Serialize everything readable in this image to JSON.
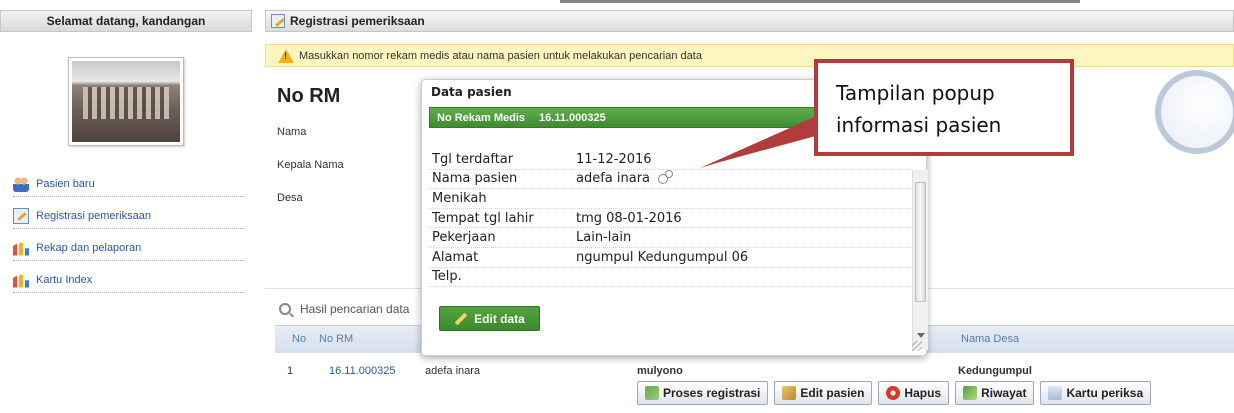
{
  "sidebar": {
    "welcome": "Selamat datang, kandangan",
    "items": [
      {
        "label": "Pasien baru",
        "icon": "users-icon"
      },
      {
        "label": "Registrasi pemeriksaan",
        "icon": "edit-form-icon"
      },
      {
        "label": "Rekap dan pelaporan",
        "icon": "bar-chart-icon"
      },
      {
        "label": "Kartu Index",
        "icon": "bar-chart-icon"
      }
    ]
  },
  "main": {
    "title": "Registrasi pemeriksaan",
    "alert": "Masukkan nomor rekam medis atau nama pasien untuk melakukan pencarian data",
    "heading": "No RM",
    "labels": {
      "nama": "Nama",
      "kepala": "Kepala Nama",
      "desa": "Desa"
    }
  },
  "results": {
    "title": "Hasil pencarian data",
    "columns": {
      "no": "No",
      "rm": "No RM",
      "desa": "Nama Desa"
    },
    "row": {
      "no": "1",
      "rm": "16.11.000325",
      "nama": "adefa inara",
      "kepala": "mulyono",
      "desa": "Kedungumpul"
    },
    "buttons": {
      "proses": "Proses registrasi",
      "edit": "Edit pasien",
      "hapus": "Hapus",
      "riwayat": "Riwayat",
      "kartu": "Kartu periksa"
    }
  },
  "popup": {
    "title": "Data pasien",
    "band_label": "No Rekam Medis",
    "band_value": "16.11.000325",
    "rows": [
      {
        "label": "Tgl terdaftar",
        "value": "11-12-2016"
      },
      {
        "label": "Nama pasien",
        "value": "adefa inara"
      },
      {
        "label": "Menikah",
        "value": ""
      },
      {
        "label": "Tempat tgl lahir",
        "value": "tmg 08-01-2016"
      },
      {
        "label": "Pekerjaan",
        "value": "Lain-lain"
      },
      {
        "label": "Alamat",
        "value": "ngumpul Kedungumpul 06"
      },
      {
        "label": "Telp.",
        "value": ""
      }
    ],
    "edit_button": "Edit data"
  },
  "callout": {
    "line1": "Tampilan popup",
    "line2": "informasi pasien"
  },
  "colors": {
    "accent_green": "#3f8c31",
    "alert_bg": "#fff5c0",
    "callout_border": "#b23b3b",
    "link": "#2a5a9a"
  }
}
